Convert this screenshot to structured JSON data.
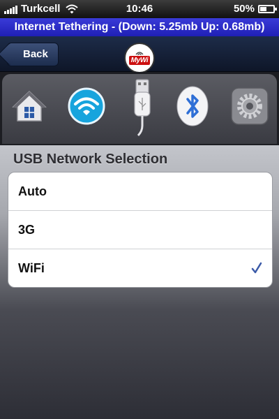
{
  "status_bar": {
    "carrier": "Turkcell",
    "time": "10:46",
    "battery": "50%",
    "battery_level": 0.5,
    "icons": [
      "signal-icon",
      "wifi-icon",
      "battery-icon"
    ]
  },
  "banner": {
    "text": "Internet Tethering - (Down: 5.25mb Up: 0.68mb)",
    "color": "#2a2ac8"
  },
  "nav": {
    "back_label": "Back",
    "logo_text": "MyWi"
  },
  "tabs": [
    {
      "name": "home",
      "icon": "home-icon"
    },
    {
      "name": "wifi",
      "icon": "wifi-icon"
    },
    {
      "name": "usb",
      "icon": "usb-icon",
      "selected": true
    },
    {
      "name": "bluetooth",
      "icon": "bluetooth-icon"
    },
    {
      "name": "settings",
      "icon": "gear-icon"
    }
  ],
  "section": {
    "title": "USB Network Selection",
    "options": [
      {
        "label": "Auto",
        "checked": false
      },
      {
        "label": "3G",
        "checked": false
      },
      {
        "label": "WiFi",
        "checked": true
      }
    ],
    "check_color": "#3b5aa8"
  }
}
